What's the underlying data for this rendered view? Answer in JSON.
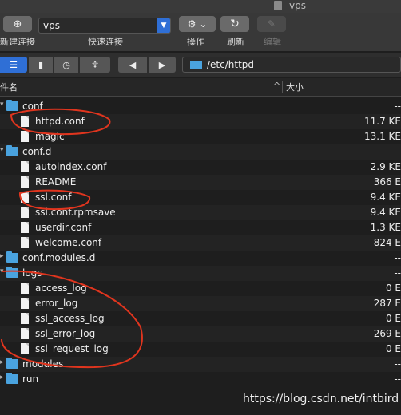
{
  "window": {
    "title": "vps"
  },
  "toolbar": {
    "new_conn": "新建连接",
    "quick_value": "vps",
    "quick_label": "快速连接",
    "actions": "操作",
    "refresh": "刷新",
    "edit": "编辑"
  },
  "nav": {
    "views": [
      "list-view-icon",
      "bookmarks-icon",
      "history-icon",
      "bonjour-icon"
    ],
    "path": "/etc/httpd"
  },
  "columns": {
    "name": "件名",
    "size": "大小"
  },
  "rows": [
    {
      "name": "conf",
      "type": "folder",
      "size": "--"
    },
    {
      "name": "httpd.conf",
      "type": "file",
      "size": "11.7 KE"
    },
    {
      "name": "magic",
      "type": "file",
      "size": "13.1 KE"
    },
    {
      "name": "conf.d",
      "type": "folder",
      "size": "--"
    },
    {
      "name": "autoindex.conf",
      "type": "file",
      "size": "2.9 KE"
    },
    {
      "name": "README",
      "type": "file",
      "size": "366 E"
    },
    {
      "name": "ssl.conf",
      "type": "file",
      "size": "9.4 KE"
    },
    {
      "name": "ssl.conf.rpmsave",
      "type": "file",
      "size": "9.4 KE"
    },
    {
      "name": "userdir.conf",
      "type": "file",
      "size": "1.3 KE"
    },
    {
      "name": "welcome.conf",
      "type": "file",
      "size": "824 E"
    },
    {
      "name": "conf.modules.d",
      "type": "folder",
      "size": "--"
    },
    {
      "name": "logs",
      "type": "folder",
      "size": "--"
    },
    {
      "name": "access_log",
      "type": "file",
      "size": "0 E"
    },
    {
      "name": "error_log",
      "type": "file",
      "size": "287 E"
    },
    {
      "name": "ssl_access_log",
      "type": "file",
      "size": "0 E"
    },
    {
      "name": "ssl_error_log",
      "type": "file",
      "size": "269 E"
    },
    {
      "name": "ssl_request_log",
      "type": "file",
      "size": "0 E"
    },
    {
      "name": "modules",
      "type": "folder",
      "size": "--"
    },
    {
      "name": "run",
      "type": "folder",
      "size": "--"
    }
  ],
  "annotation_color": "#e0351e",
  "watermark": "https://blog.csdn.net/intbird"
}
